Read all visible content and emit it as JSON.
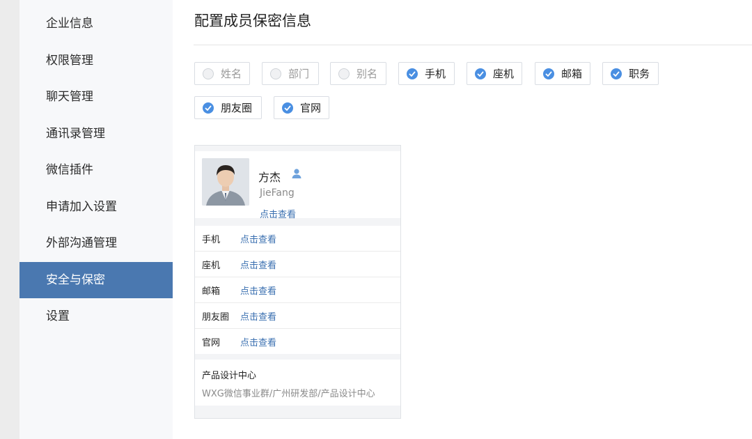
{
  "sidebar": {
    "items": [
      {
        "label": "企业信息"
      },
      {
        "label": "权限管理"
      },
      {
        "label": "聊天管理"
      },
      {
        "label": "通讯录管理"
      },
      {
        "label": "微信插件"
      },
      {
        "label": "申请加入设置"
      },
      {
        "label": "外部沟通管理"
      },
      {
        "label": "安全与保密",
        "active": true
      },
      {
        "label": "设置"
      }
    ]
  },
  "main": {
    "title": "配置成员保密信息",
    "options": [
      {
        "label": "姓名",
        "checked": false
      },
      {
        "label": "部门",
        "checked": false
      },
      {
        "label": "别名",
        "checked": false
      },
      {
        "label": "手机",
        "checked": true
      },
      {
        "label": "座机",
        "checked": true
      },
      {
        "label": "邮箱",
        "checked": true
      },
      {
        "label": "职务",
        "checked": true
      },
      {
        "label": "朋友圈",
        "checked": true
      },
      {
        "label": "官网",
        "checked": true
      }
    ]
  },
  "card": {
    "name": "方杰",
    "english_name": "JieFang",
    "view_link": "点击查看",
    "rows": [
      {
        "label": "手机",
        "value": "点击查看"
      },
      {
        "label": "座机",
        "value": "点击查看"
      },
      {
        "label": "邮箱",
        "value": "点击查看"
      },
      {
        "label": "朋友圈",
        "value": "点击查看"
      },
      {
        "label": "官网",
        "value": "点击查看"
      }
    ],
    "department": "产品设计中心",
    "department_path": "WXG微信事业群/广州研发部/产品设计中心"
  },
  "colors": {
    "accent": "#4a78b0",
    "checkbox": "#4a8fe2",
    "link": "#3a6fb0"
  },
  "icons": {
    "checked": "check-circle-icon",
    "unchecked": "empty-circle-icon",
    "person": "person-icon"
  }
}
